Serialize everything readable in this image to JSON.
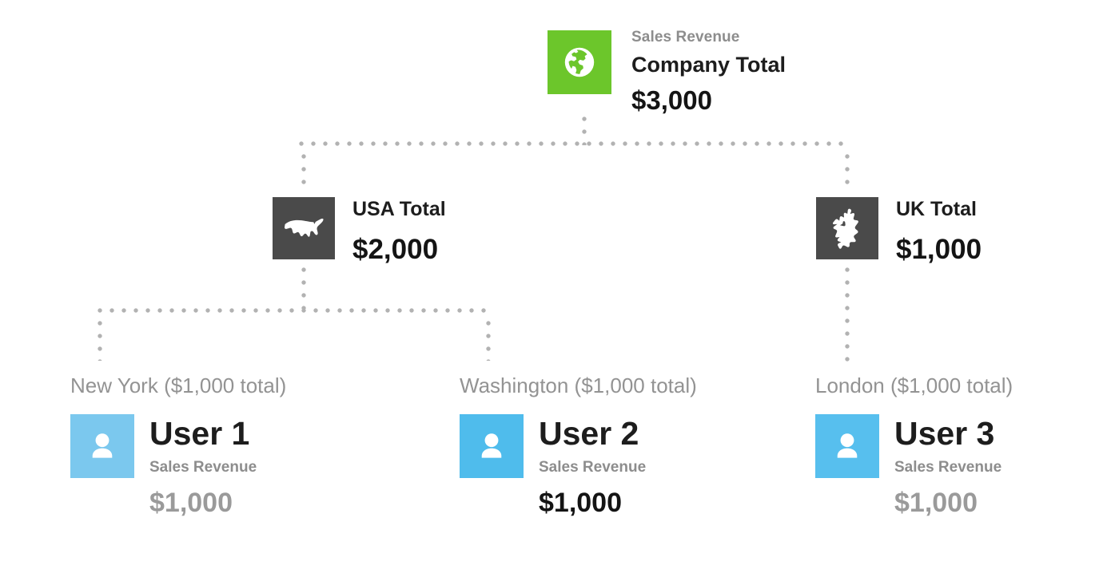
{
  "diagram": {
    "type": "org-hierarchy-rollup",
    "background_color": "#ffffff",
    "connector_color": "#b2b2b2"
  },
  "root": {
    "kicker": "Sales Revenue",
    "title": "Company Total",
    "amount": "$3,000",
    "icon": "globe-icon",
    "icon_bg": "#6cc62b",
    "icon_fg": "#ffffff"
  },
  "regions": [
    {
      "id": "usa",
      "title": "USA Total",
      "amount": "$2,000",
      "icon": "usa-map-icon",
      "icon_bg": "#4a4a4a",
      "icon_fg": "#ffffff"
    },
    {
      "id": "uk",
      "title": "UK Total",
      "amount": "$1,000",
      "icon": "uk-map-icon",
      "icon_bg": "#4a4a4a",
      "icon_fg": "#ffffff"
    }
  ],
  "cities": [
    {
      "id": "newyork",
      "label": "New York ($1,000 total)",
      "user_name": "User 1",
      "user_kicker": "Sales Revenue",
      "user_amount": "$1,000",
      "avatar_icon": "user-avatar-icon",
      "avatar_bg": "#7bc8ee",
      "avatar_fg": "#ffffff",
      "name_color": "#1d1d1d",
      "kicker_color": "#8d8d8d",
      "amount_color": "#9a9a9a"
    },
    {
      "id": "washington",
      "label": "Washington ($1,000 total)",
      "user_name": "User 2",
      "user_kicker": "Sales Revenue",
      "user_amount": "$1,000",
      "avatar_icon": "user-avatar-icon",
      "avatar_bg": "#4fbcec",
      "avatar_fg": "#ffffff",
      "name_color": "#1d1d1d",
      "kicker_color": "#8d8d8d",
      "amount_color": "#141414"
    },
    {
      "id": "london",
      "label": "London ($1,000 total)",
      "user_name": "User 3",
      "user_kicker": "Sales Revenue",
      "user_amount": "$1,000",
      "avatar_icon": "user-avatar-icon",
      "avatar_bg": "#57bfee",
      "avatar_fg": "#ffffff",
      "name_color": "#1d1d1d",
      "kicker_color": "#8d8d8d",
      "amount_color": "#9a9a9a"
    }
  ],
  "chart_data": {
    "type": "table",
    "title": "Sales Revenue rollup",
    "categories": [
      "Company Total",
      "USA Total",
      "UK Total",
      "New York",
      "Washington",
      "London",
      "User 1",
      "User 2",
      "User 3"
    ],
    "values": [
      3000,
      2000,
      1000,
      1000,
      1000,
      1000,
      1000,
      1000,
      1000
    ]
  }
}
